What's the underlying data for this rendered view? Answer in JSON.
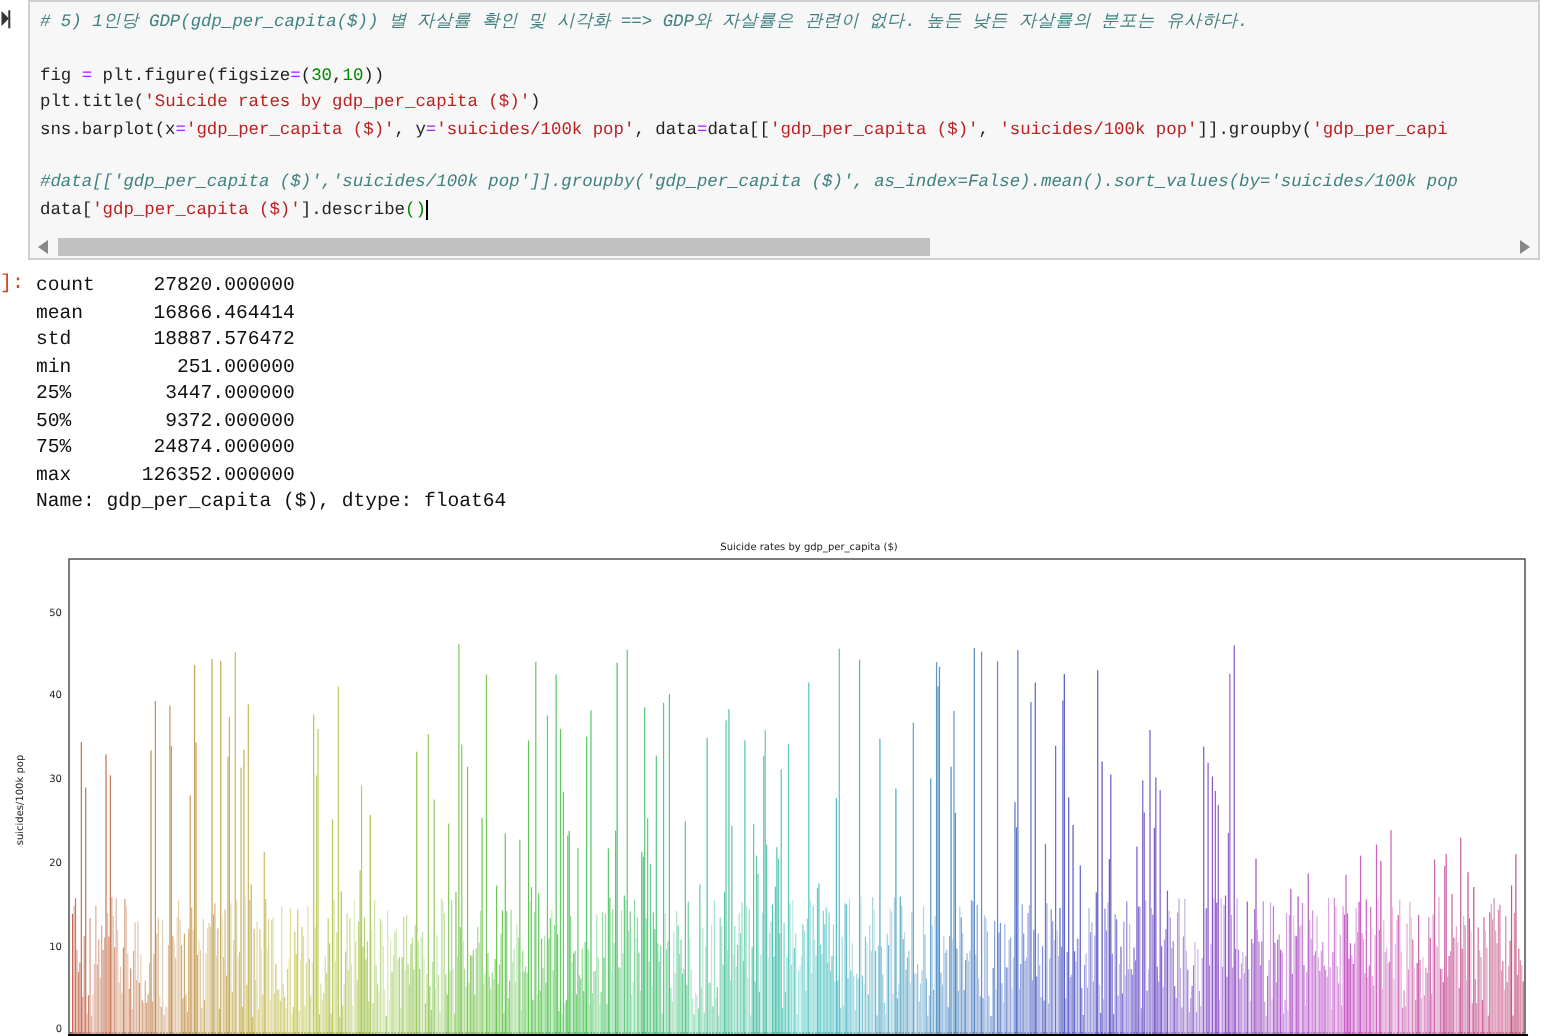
{
  "code_cell": {
    "run_glyph": "⏵|",
    "lines": [
      {
        "gap_before": false,
        "tokens": [
          {
            "kind": "comment",
            "text": "# 5) 1인당 GDP(gdp_per_capita($)) 별 자살률 확인 및 시각화 ==> GDP와 자살률은 관련이 없다. 높든 낮든 자살률의 분포는 유사하다."
          }
        ]
      },
      {
        "gap_before": true,
        "tokens": [
          {
            "kind": "plain",
            "text": "fig "
          },
          {
            "kind": "op",
            "text": "="
          },
          {
            "kind": "plain",
            "text": " plt.figure(figsize"
          },
          {
            "kind": "op",
            "text": "="
          },
          {
            "kind": "plain",
            "text": "("
          },
          {
            "kind": "number",
            "text": "30"
          },
          {
            "kind": "plain",
            "text": ","
          },
          {
            "kind": "number",
            "text": "10"
          },
          {
            "kind": "plain",
            "text": "))"
          }
        ]
      },
      {
        "gap_before": false,
        "tokens": [
          {
            "kind": "plain",
            "text": "plt.title("
          },
          {
            "kind": "string",
            "text": "'Suicide rates by gdp_per_capita ($)'"
          },
          {
            "kind": "plain",
            "text": ")"
          }
        ]
      },
      {
        "gap_before": false,
        "tokens": [
          {
            "kind": "plain",
            "text": "sns.barplot(x"
          },
          {
            "kind": "op",
            "text": "="
          },
          {
            "kind": "string",
            "text": "'gdp_per_capita ($)'"
          },
          {
            "kind": "plain",
            "text": ", y"
          },
          {
            "kind": "op",
            "text": "="
          },
          {
            "kind": "string",
            "text": "'suicides/100k pop'"
          },
          {
            "kind": "plain",
            "text": ", data"
          },
          {
            "kind": "op",
            "text": "="
          },
          {
            "kind": "plain",
            "text": "data[["
          },
          {
            "kind": "string",
            "text": "'gdp_per_capita ($)'"
          },
          {
            "kind": "plain",
            "text": ", "
          },
          {
            "kind": "string",
            "text": "'suicides/100k pop'"
          },
          {
            "kind": "plain",
            "text": "]].groupby("
          },
          {
            "kind": "string",
            "text": "'gdp_per_capi"
          }
        ]
      },
      {
        "gap_before": true,
        "tokens": [
          {
            "kind": "comment",
            "text": "#data[['gdp_per_capita ($)','suicides/100k pop']].groupby('gdp_per_capita ($)', as_index=False).mean().sort_values(by='suicides/100k pop"
          }
        ]
      },
      {
        "gap_before": false,
        "tokens": [
          {
            "kind": "plain",
            "text": "data["
          },
          {
            "kind": "string",
            "text": "'gdp_per_capita ($)'"
          },
          {
            "kind": "plain",
            "text": "].describe"
          },
          {
            "kind": "bracket",
            "text": "()"
          }
        ]
      }
    ]
  },
  "output": {
    "prompt": "]:",
    "lines": [
      "count     27820.000000",
      "mean      16866.464414",
      "std       18887.576472",
      "min         251.000000",
      "25%        3447.000000",
      "50%        9372.000000",
      "75%       24874.000000",
      "max      126352.000000",
      "Name: gdp_per_capita ($), dtype: float64"
    ]
  },
  "figure": {
    "title": "Suicide rates by gdp_per_capita ($)",
    "ylabel": "suicides/100k pop",
    "yticks": [
      "50",
      "40",
      "30",
      "20",
      "10",
      "0"
    ]
  }
}
